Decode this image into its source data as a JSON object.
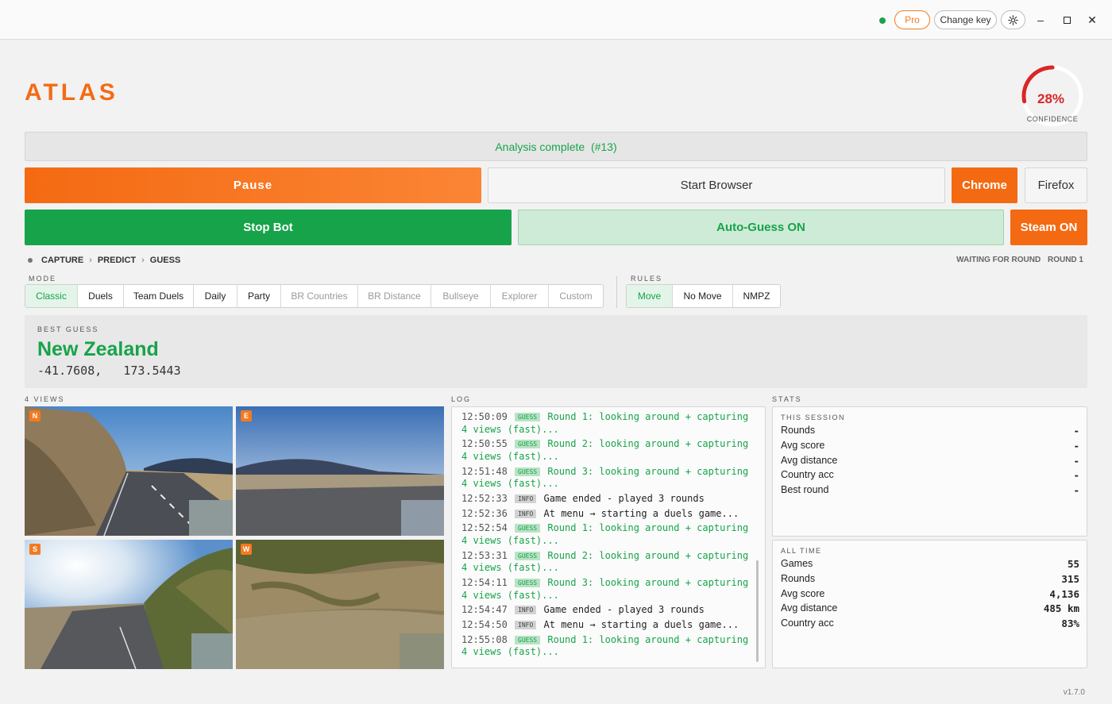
{
  "titlebar": {
    "pro_label": "Pro",
    "change_key_label": "Change key",
    "settings_icon": "gear-icon",
    "minimize_glyph": "–",
    "maximize_glyph": "☐",
    "close_glyph": "✕"
  },
  "header": {
    "logo": "ATLAS",
    "confidence_value": "28%",
    "confidence_fraction": 0.28,
    "confidence_label": "CONFIDENCE"
  },
  "status": {
    "text": "Analysis complete  (#13)"
  },
  "controls": {
    "pause_label": "Pause",
    "start_browser_label": "Start Browser",
    "chrome_label": "Chrome",
    "firefox_label": "Firefox",
    "stop_bot_label": "Stop Bot",
    "auto_guess_label": "Auto-Guess ON",
    "steam_label": "Steam ON"
  },
  "pipeline": {
    "steps": [
      "CAPTURE",
      "PREDICT",
      "GUESS"
    ],
    "waiting_label": "WAITING FOR ROUND",
    "round_label": "ROUND 1"
  },
  "mode": {
    "label": "MODE",
    "options": [
      {
        "label": "Classic",
        "state": "active"
      },
      {
        "label": "Duels",
        "state": "normal"
      },
      {
        "label": "Team Duels",
        "state": "normal"
      },
      {
        "label": "Daily",
        "state": "normal"
      },
      {
        "label": "Party",
        "state": "normal"
      },
      {
        "label": "BR Countries",
        "state": "disabled"
      },
      {
        "label": "BR Distance",
        "state": "disabled"
      },
      {
        "label": "Bullseye",
        "state": "disabled"
      },
      {
        "label": "Explorer",
        "state": "disabled"
      },
      {
        "label": "Custom",
        "state": "disabled"
      }
    ]
  },
  "rules": {
    "label": "RULES",
    "options": [
      {
        "label": "Move",
        "state": "active"
      },
      {
        "label": "No Move",
        "state": "normal"
      },
      {
        "label": "NMPZ",
        "state": "normal"
      }
    ]
  },
  "best_guess": {
    "label": "BEST GUESS",
    "country": "New Zealand",
    "lat": "-41.7608,",
    "lon": "173.5443"
  },
  "views": {
    "label": "4 VIEWS",
    "tags": [
      "N",
      "E",
      "S",
      "W"
    ]
  },
  "log": {
    "label": "LOG",
    "entries": [
      {
        "time": "12:50:09",
        "level": "GUESS",
        "text": "Round 1: looking around + capturing 4 views (fast)..."
      },
      {
        "time": "12:50:55",
        "level": "GUESS",
        "text": "Round 2: looking around + capturing 4 views (fast)..."
      },
      {
        "time": "12:51:48",
        "level": "GUESS",
        "text": "Round 3: looking around + capturing 4 views (fast)..."
      },
      {
        "time": "12:52:33",
        "level": "INFO",
        "text": "Game ended - played 3 rounds"
      },
      {
        "time": "12:52:36",
        "level": "INFO",
        "text": "At menu → starting a duels game..."
      },
      {
        "time": "12:52:54",
        "level": "GUESS",
        "text": "Round 1: looking around + capturing 4 views (fast)..."
      },
      {
        "time": "12:53:31",
        "level": "GUESS",
        "text": "Round 2: looking around + capturing 4 views (fast)..."
      },
      {
        "time": "12:54:11",
        "level": "GUESS",
        "text": "Round 3: looking around + capturing 4 views (fast)..."
      },
      {
        "time": "12:54:47",
        "level": "INFO",
        "text": "Game ended - played 3 rounds"
      },
      {
        "time": "12:54:50",
        "level": "INFO",
        "text": "At menu → starting a duels game..."
      },
      {
        "time": "12:55:08",
        "level": "GUESS",
        "text": "Round 1: looking around + capturing 4 views (fast)..."
      }
    ]
  },
  "stats": {
    "label": "STATS",
    "session": {
      "title": "THIS SESSION",
      "rows": [
        {
          "label": "Rounds",
          "value": "-"
        },
        {
          "label": "Avg score",
          "value": "-"
        },
        {
          "label": "Avg distance",
          "value": "-"
        },
        {
          "label": "Country acc",
          "value": "-"
        },
        {
          "label": "Best round",
          "value": "-"
        }
      ]
    },
    "all_time": {
      "title": "ALL TIME",
      "rows": [
        {
          "label": "Games",
          "value": "55"
        },
        {
          "label": "Rounds",
          "value": "315"
        },
        {
          "label": "Avg score",
          "value": "4,136"
        },
        {
          "label": "Avg distance",
          "value": "485 km"
        },
        {
          "label": "Country acc",
          "value": "83%"
        }
      ]
    }
  },
  "version": "v1.7.0",
  "colors": {
    "accent": "#f46a12",
    "success": "#17a34a",
    "danger": "#d92626"
  }
}
